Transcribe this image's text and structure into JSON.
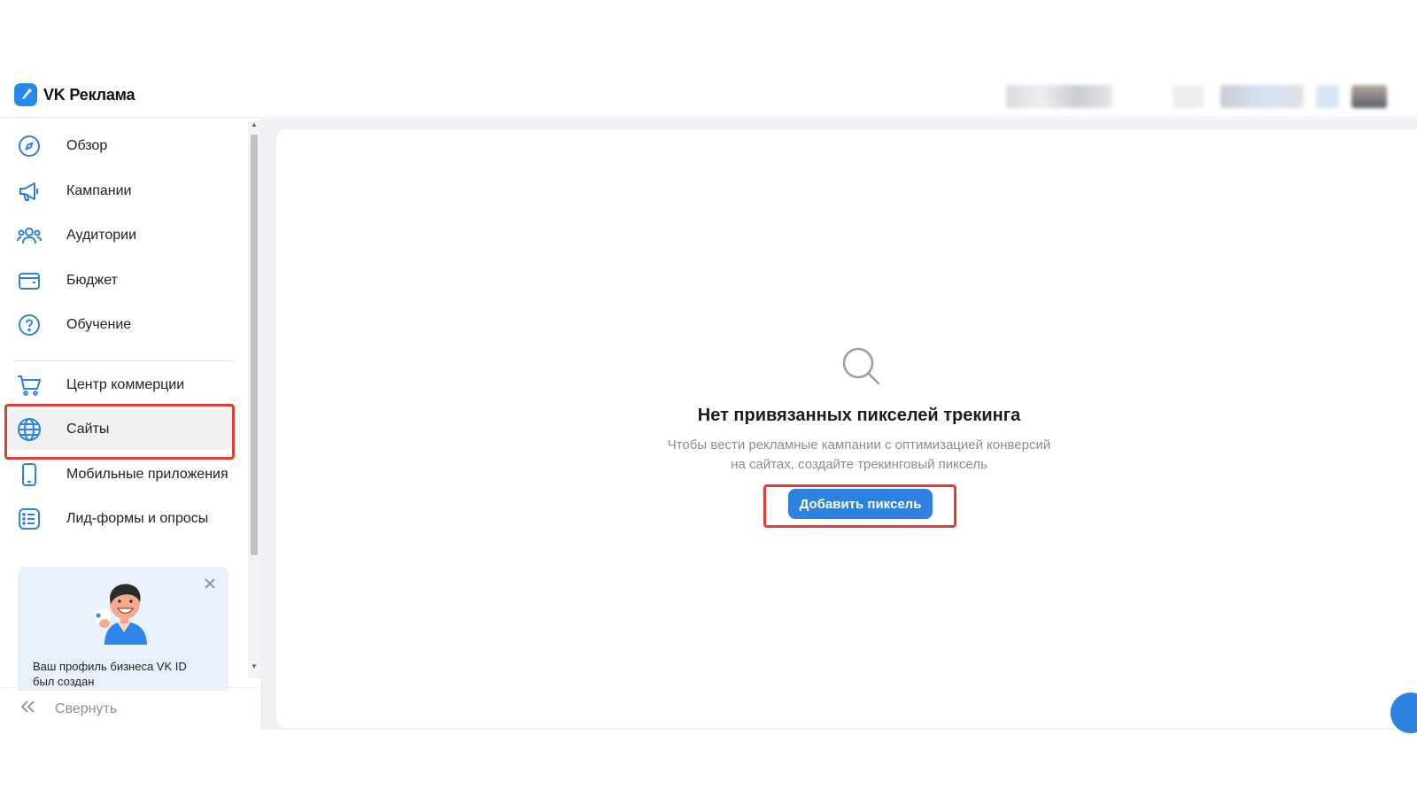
{
  "app": {
    "title": "VK Реклама"
  },
  "sidebar": {
    "items": [
      {
        "label": "Обзор",
        "icon": "compass-icon"
      },
      {
        "label": "Кампании",
        "icon": "megaphone-icon"
      },
      {
        "label": "Аудитории",
        "icon": "users-icon"
      },
      {
        "label": "Бюджет",
        "icon": "wallet-icon"
      },
      {
        "label": "Обучение",
        "icon": "help-circle-icon"
      },
      {
        "label": "Центр коммерции",
        "icon": "cart-icon"
      },
      {
        "label": "Сайты",
        "icon": "globe-icon",
        "active": true
      },
      {
        "label": "Мобильные приложения",
        "icon": "smartphone-icon"
      },
      {
        "label": "Лид-формы и опросы",
        "icon": "list-icon"
      }
    ],
    "promo": {
      "text": "Ваш профиль бизнеса VK ID был создан"
    },
    "collapse_label": "Свернуть"
  },
  "main": {
    "empty_state": {
      "title": "Нет привязанных пикселей трекинга",
      "description_line1": "Чтобы вести рекламные кампании с оптимизацией конверсий",
      "description_line2": "на сайтах, создайте трекинговый пиксель",
      "button_label": "Добавить пиксель"
    }
  },
  "colors": {
    "accent": "#2d81e0",
    "highlight": "#e63b35",
    "icon": "#2d81e0"
  }
}
